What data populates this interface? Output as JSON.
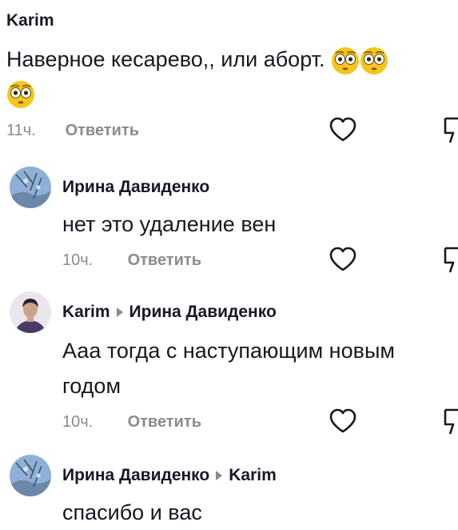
{
  "comments": [
    {
      "author": "Karim",
      "text": "Наверное кесарево,, или аборт.",
      "time": "11ч.",
      "reply_label": "Ответить"
    },
    {
      "author": "Ирина Давиденко",
      "text": "нет это удаление вен",
      "time": "10ч.",
      "reply_label": "Ответить"
    },
    {
      "author": "Karim",
      "reply_to": "Ирина Давиденко",
      "text_line1": "Ааа тогда с наступающим новым",
      "text_line2": "годом",
      "time": "10ч.",
      "reply_label": "Ответить"
    },
    {
      "author": "Ирина Давиденко",
      "reply_to": "Karim",
      "text": "спасибо и вас"
    }
  ],
  "icons": {
    "like": "heart-outline-icon",
    "dislike": "thumbs-down-icon",
    "emoji": "flushed-face-emoji",
    "reply_arrow": "caret-right-icon"
  },
  "colors": {
    "text": "#161823",
    "secondary": "#8a8b91",
    "emoji_face": "#f6c51b"
  }
}
